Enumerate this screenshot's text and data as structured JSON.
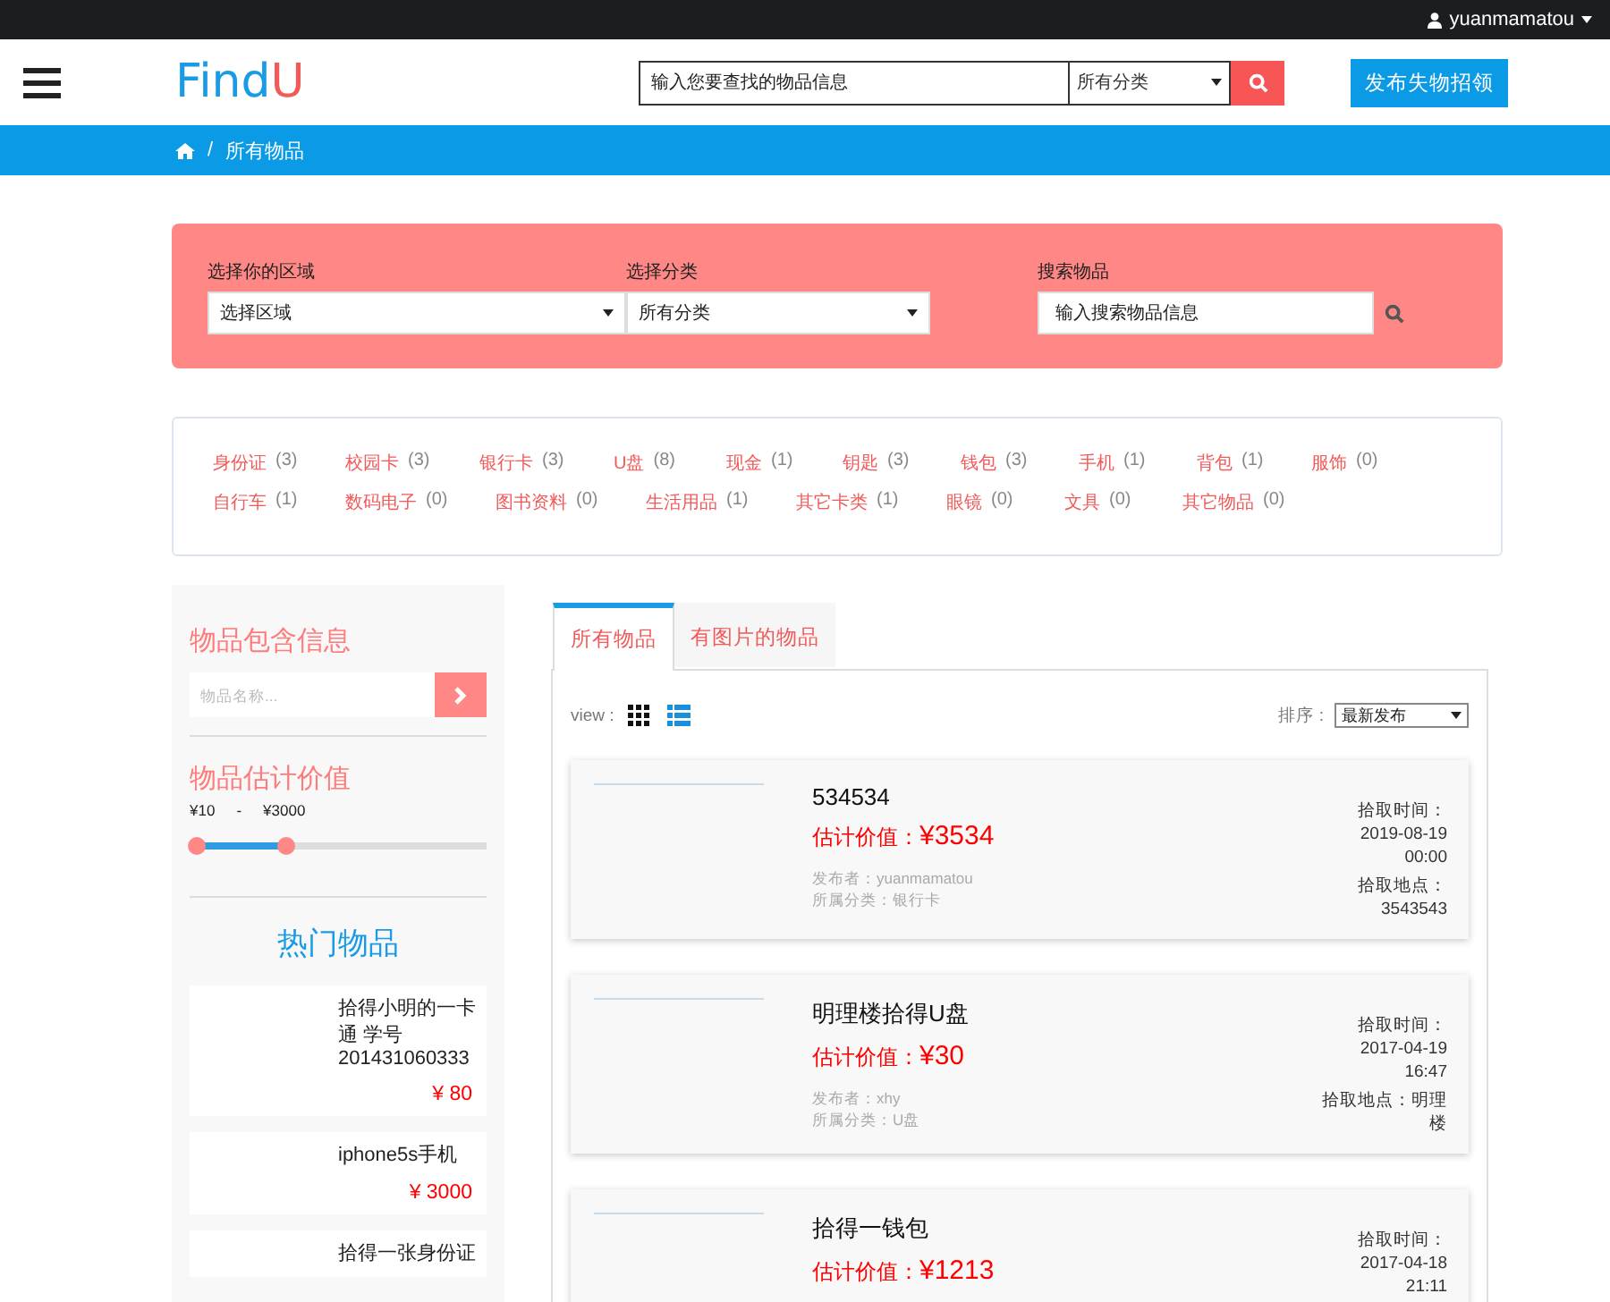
{
  "top_bar": {
    "user": "yuanmamatou"
  },
  "header": {
    "logo_left": "Find",
    "logo_right": "U",
    "search": {
      "placeholder": "输入您要查找的物品信息"
    },
    "category": "所有分类",
    "post_button": "发布失物招领"
  },
  "breadcrumb": {
    "separator": "/",
    "items": [
      "所有物品"
    ]
  },
  "filter": {
    "fields": [
      {
        "kind": "select",
        "label": "选择你的区域",
        "value": "选择区域"
      },
      {
        "kind": "select",
        "label": "选择分类",
        "value": "所有分类"
      },
      {
        "kind": "search",
        "label": "搜索物品",
        "placeholder": "输入搜索物品信息"
      }
    ]
  },
  "tags": [
    {
      "name": "身份证",
      "count": "(3)"
    },
    {
      "name": "校园卡",
      "count": "(3)"
    },
    {
      "name": "银行卡",
      "count": "(3)"
    },
    {
      "name": "U盘",
      "count": "(8)"
    },
    {
      "name": "现金",
      "count": "(1)"
    },
    {
      "name": "钥匙",
      "count": "(3)"
    },
    {
      "name": "钱包",
      "count": "(3)"
    },
    {
      "name": "手机",
      "count": "(1)"
    },
    {
      "name": "背包",
      "count": "(1)"
    },
    {
      "name": "服饰",
      "count": "(0)"
    },
    {
      "name": "自行车",
      "count": "(1)"
    },
    {
      "name": "数码电子",
      "count": "(0)"
    },
    {
      "name": "图书资料",
      "count": "(0)"
    },
    {
      "name": "生活用品",
      "count": "(1)"
    },
    {
      "name": "其它卡类",
      "count": "(1)"
    },
    {
      "name": "眼镜",
      "count": "(0)"
    },
    {
      "name": "文具",
      "count": "(0)"
    },
    {
      "name": "其它物品",
      "count": "(0)"
    }
  ],
  "sidebar": {
    "info_title": "物品包含信息",
    "info_placeholder": "物品名称...",
    "value_title": "物品估计价值",
    "range_min": "¥10",
    "range_sep": "-",
    "range_max": "¥3000",
    "level": 0.31,
    "hot_title": "热门物品",
    "hot_items": [
      {
        "title": "拾得小明的一卡通 学号201431060333",
        "price": "¥ 80"
      },
      {
        "title": "iphone5s手机",
        "price": "¥ 3000"
      },
      {
        "title": "拾得一张身份证"
      }
    ]
  },
  "tabs": [
    {
      "label": "所有物品",
      "selected": true
    },
    {
      "label": "有图片的物品",
      "selected": false
    }
  ],
  "view": {
    "label": "view :",
    "modes": [
      {
        "kind": "grid",
        "selected": false
      },
      {
        "kind": "list",
        "selected": true
      }
    ]
  },
  "sort": {
    "label": "排序 :",
    "value": "最新发布"
  },
  "items": [
    {
      "title": "534534",
      "value_label": "估计价值：",
      "value": "¥3534",
      "poster": "发布者：yuanmamatou",
      "category": "所属分类：银行卡",
      "time": "拾取时间：2019-08-19 00:00",
      "place": "拾取地点：3543543"
    },
    {
      "title": "明理楼拾得U盘",
      "value_label": "估计价值：",
      "value": "¥30",
      "poster": "发布者：xhy",
      "category": "所属分类：U盘",
      "time": "拾取时间：2017-04-19 16:47",
      "place": "拾取地点：明理楼"
    },
    {
      "title": "拾得一钱包",
      "value_label": "估计价值：",
      "value": "¥1213",
      "time": "拾取时间：2017-04-18 21:11"
    }
  ]
}
